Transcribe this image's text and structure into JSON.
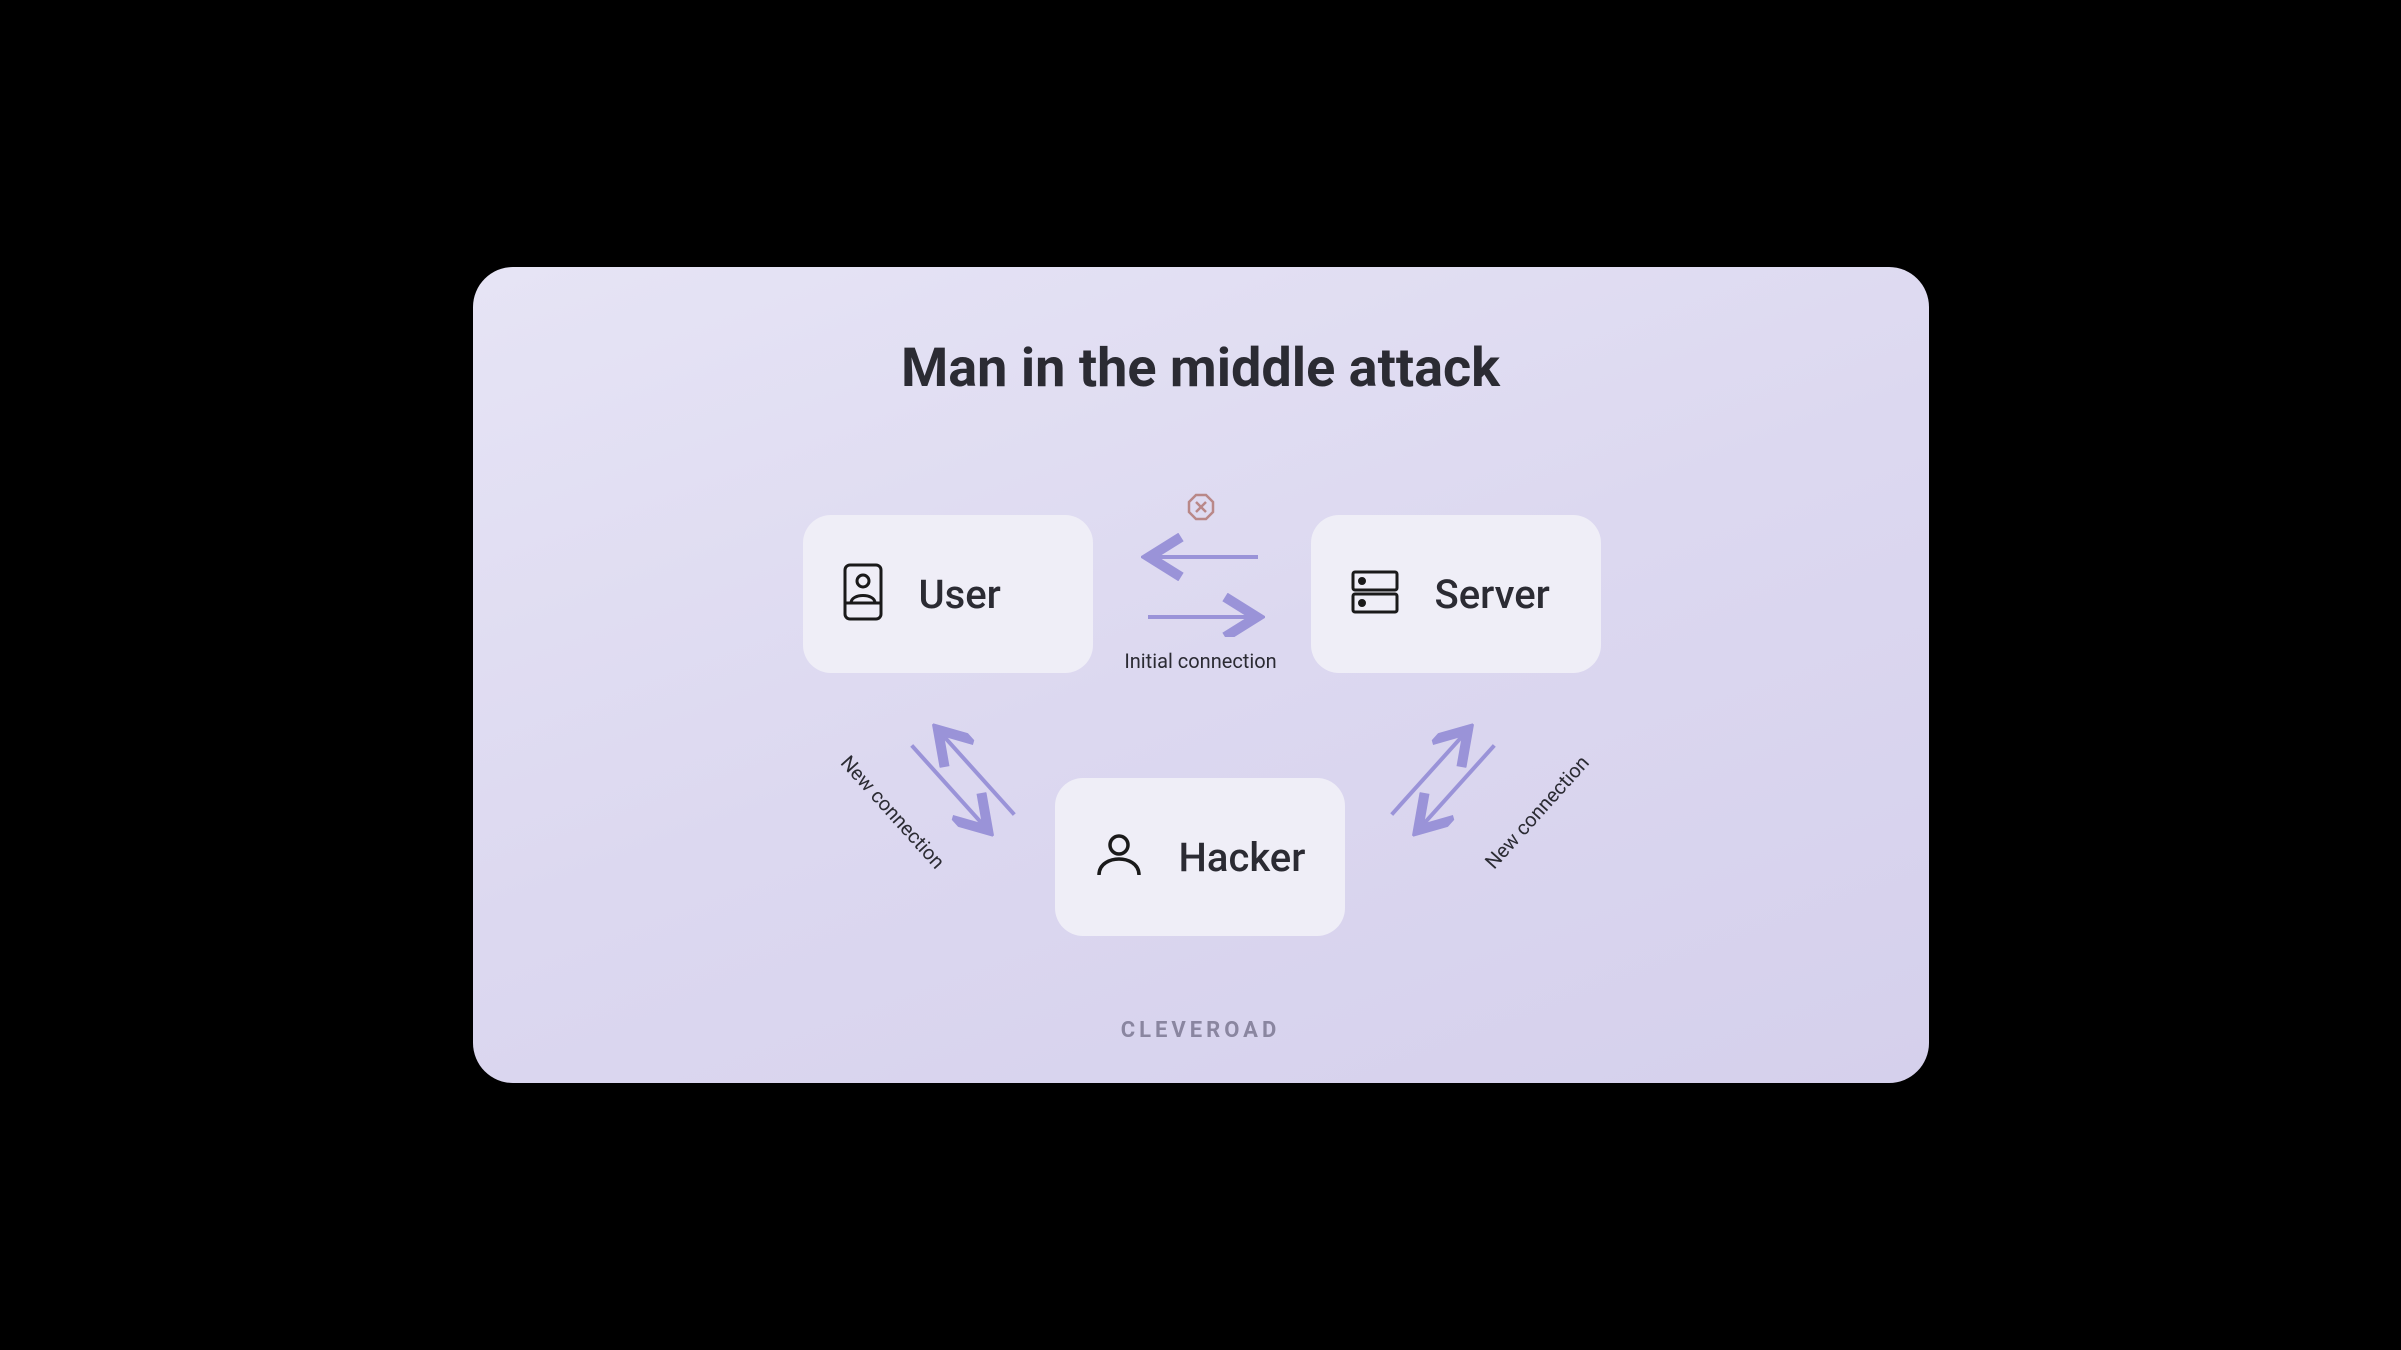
{
  "title": "Man in the middle attack",
  "nodes": {
    "user": {
      "label": "User",
      "icon": "phone-user-icon"
    },
    "server": {
      "label": "Server",
      "icon": "server-icon"
    },
    "hacker": {
      "label": "Hacker",
      "icon": "person-icon"
    }
  },
  "connections": {
    "initial": {
      "label": "Initial connection",
      "blocked": true
    },
    "left": {
      "label": "New connection"
    },
    "right": {
      "label": "New connection"
    }
  },
  "colors": {
    "arrow": "#9a93d8",
    "blocked": "#b98888",
    "text": "#2b2b33",
    "node_bg": "#efeef7"
  },
  "brand": "CLEVEROAD"
}
